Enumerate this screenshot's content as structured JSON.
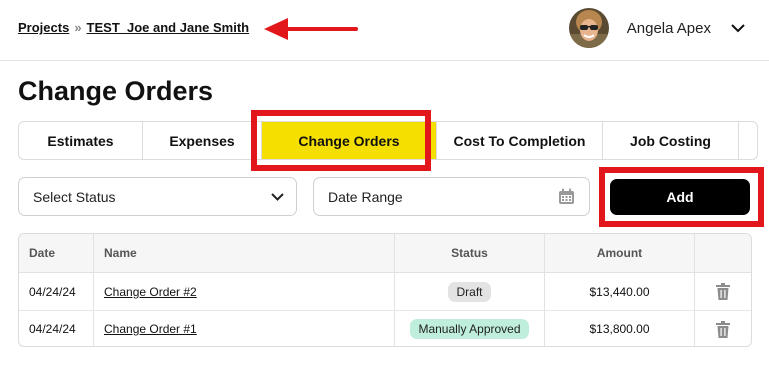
{
  "breadcrumb": {
    "root": "Projects",
    "separator": "»",
    "current": "TEST_Joe and Jane Smith"
  },
  "user": {
    "name": "Angela Apex"
  },
  "page": {
    "title": "Change Orders"
  },
  "tabs": [
    {
      "label": "Estimates",
      "active": false
    },
    {
      "label": "Expenses",
      "active": false
    },
    {
      "label": "Change Orders",
      "active": true
    },
    {
      "label": "Cost To Completion",
      "active": false
    },
    {
      "label": "Job Costing",
      "active": false
    }
  ],
  "filters": {
    "status_placeholder": "Select Status",
    "date_placeholder": "Date Range"
  },
  "actions": {
    "add_label": "Add"
  },
  "table": {
    "headers": {
      "date": "Date",
      "name": "Name",
      "status": "Status",
      "amount": "Amount"
    },
    "rows": [
      {
        "date": "04/24/24",
        "name": "Change Order #2",
        "status": "Draft",
        "amount": "$13,440.00"
      },
      {
        "date": "04/24/24",
        "name": "Change Order #1",
        "status": "Manually Approved",
        "amount": "$13,800.00"
      }
    ]
  },
  "colors": {
    "active_tab": "#f5df00",
    "annotation": "#e2171c",
    "draft_badge": "#e3e3e3",
    "approved_badge": "#bfeedd",
    "add_button": "#000000"
  }
}
